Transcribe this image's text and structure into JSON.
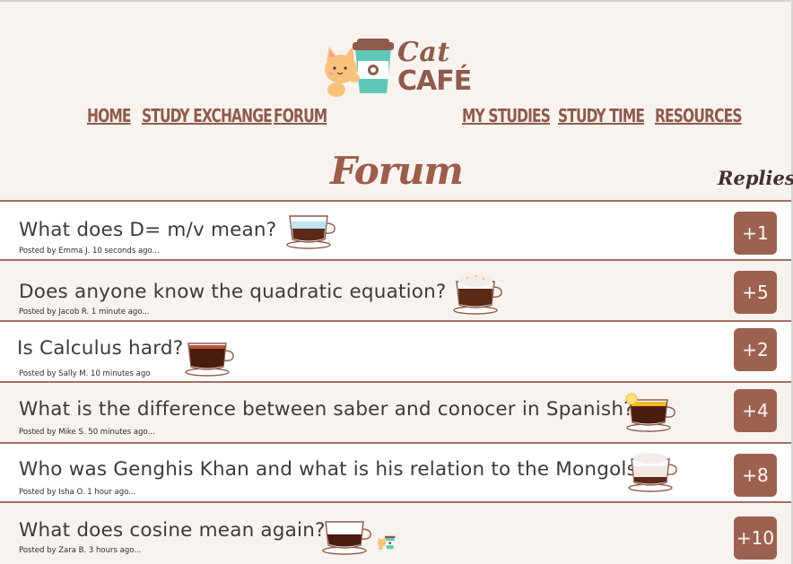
{
  "header": {
    "logo_line1": "Cat",
    "logo_line2": "CAFÉ",
    "nav": [
      "Home",
      "Study Exchange",
      "Forum",
      "My Studies",
      "Study Time",
      "Resources"
    ]
  },
  "page": {
    "title": "Forum",
    "replies_header": "Replies"
  },
  "posts": [
    {
      "question": "What does D= m/v mean?",
      "meta": "Posted by Emma J. 10 seconds ago...",
      "replies": "+1",
      "cup": "iced-coffee-cup-icon"
    },
    {
      "question": "Does anyone know the quadratic equation?",
      "meta": "Posted by Jacob R. 1 minute ago...",
      "replies": "+5",
      "cup": "cappuccino-cup-icon"
    },
    {
      "question": "Is Calculus hard?",
      "meta": "Posted by Sally M. 10 minutes ago",
      "replies": "+2",
      "cup": "black-coffee-cup-icon"
    },
    {
      "question": "What is the difference between saber and conocer in Spanish?",
      "meta": "Posted by Mike S. 50 minutes ago...",
      "replies": "+4",
      "cup": "lemon-tea-cup-icon"
    },
    {
      "question": "Who was Genghis Khan and what is his relation to the Mongols?",
      "meta": "Posted by Isha O. 1 hour ago...",
      "replies": "+8",
      "cup": "latte-cup-icon"
    },
    {
      "question": "What does cosine mean again?",
      "meta": "Posted by Zara B. 3 hours ago...",
      "replies": "+10",
      "cup": "espresso-cup-icon"
    }
  ],
  "colors": {
    "accent": "#9d6151",
    "background": "#f8f3ee",
    "divider": "#a46f62"
  }
}
